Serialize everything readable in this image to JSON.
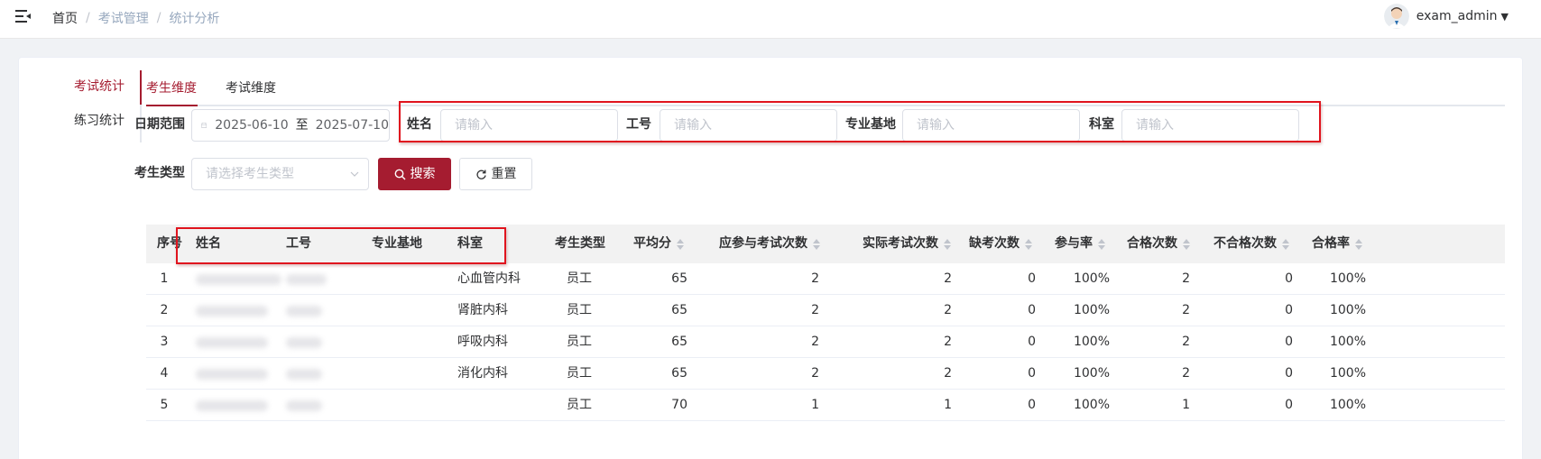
{
  "header": {
    "breadcrumb": [
      "首页",
      "考试管理",
      "统计分析"
    ],
    "username": "exam_admin",
    "menu_icon": "menu-fold-icon",
    "avatar_icon": "user-avatar-icon"
  },
  "side_tabs": [
    {
      "label": "考试统计",
      "active": true
    },
    {
      "label": "练习统计",
      "active": false
    }
  ],
  "top_tabs": [
    {
      "label": "考生维度",
      "active": true
    },
    {
      "label": "考试维度",
      "active": false
    }
  ],
  "filters": {
    "date_label": "日期范围",
    "date_start": "2025-06-10",
    "date_sep": "至",
    "date_end": "2025-07-10",
    "name_label": "姓名",
    "name_placeholder": "请输入",
    "id_label": "工号",
    "id_placeholder": "请输入",
    "base_label": "专业基地",
    "base_placeholder": "请输入",
    "dept_label": "科室",
    "dept_placeholder": "请输入",
    "type_label": "考生类型",
    "type_placeholder": "请选择考生类型",
    "search_label": "搜索",
    "reset_label": "重置"
  },
  "table": {
    "columns": [
      "序号",
      "姓名",
      "工号",
      "专业基地",
      "科室",
      "考生类型",
      "平均分",
      "应参与考试次数",
      "实际考试次数",
      "缺考次数",
      "参与率",
      "合格次数",
      "不合格次数",
      "合格率"
    ],
    "rows": [
      [
        "1",
        "",
        "",
        "",
        "心血管内科",
        "员工",
        "65",
        "2",
        "2",
        "0",
        "100%",
        "2",
        "0",
        "100%"
      ],
      [
        "2",
        "",
        "",
        "",
        "肾脏内科",
        "员工",
        "65",
        "2",
        "2",
        "0",
        "100%",
        "2",
        "0",
        "100%"
      ],
      [
        "3",
        "",
        "",
        "",
        "呼吸内科",
        "员工",
        "65",
        "2",
        "2",
        "0",
        "100%",
        "2",
        "0",
        "100%"
      ],
      [
        "4",
        "",
        "",
        "",
        "消化内科",
        "员工",
        "65",
        "2",
        "2",
        "0",
        "100%",
        "2",
        "0",
        "100%"
      ],
      [
        "5",
        "",
        "",
        "",
        "",
        "员工",
        "70",
        "1",
        "1",
        "0",
        "100%",
        "1",
        "0",
        "100%"
      ]
    ]
  },
  "colors": {
    "accent": "#a51c30",
    "annotation": "#e0141e"
  }
}
